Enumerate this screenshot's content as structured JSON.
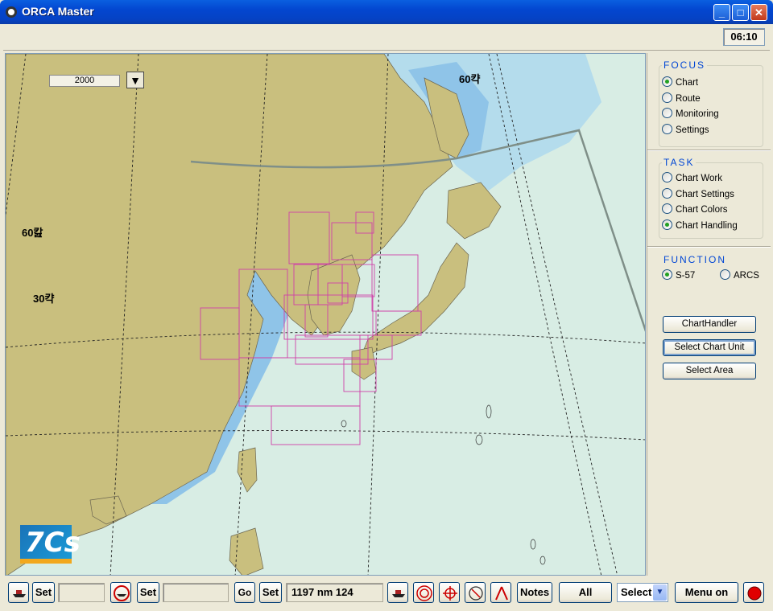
{
  "window": {
    "title": "ORCA Master",
    "minimize": "_",
    "maximize": "□",
    "close": "✕"
  },
  "header": {
    "time": "06:10"
  },
  "map": {
    "scale": "2000",
    "scale_button": "▼",
    "labels": {
      "lat_top": "60캭",
      "left_a": "60캂",
      "left_b": "30캭"
    },
    "colors": {
      "land": "#c9bf7e",
      "sea": "#d8ede4",
      "shallow": "#8fc4e8",
      "mid": "#b4dcec",
      "cells": "#d040a8"
    }
  },
  "panel": {
    "focus": {
      "title": "FOCUS",
      "items": [
        "Chart",
        "Route",
        "Monitoring",
        "Settings"
      ],
      "selected": "Chart"
    },
    "task": {
      "title": "TASK",
      "items": [
        "Chart Work",
        "Chart Settings",
        "Chart Colors",
        "Chart Handling"
      ],
      "selected": "Chart Handling"
    },
    "function": {
      "title": "FUNCTION",
      "items": [
        "S-57",
        "ARCS"
      ],
      "selected": "S-57"
    },
    "buttons": [
      "ChartHandler",
      "Select Chart Unit",
      "Select Area"
    ]
  },
  "bottom": {
    "set1": "Set",
    "field1": "",
    "set2": "Set",
    "field2": "",
    "go": "Go",
    "set3": "Set",
    "readout": "1197 nm  124",
    "notes": "Notes",
    "all": "All",
    "select": "Select",
    "menu": "Menu on"
  },
  "icons": [
    "app-icon",
    "ship-icon",
    "ship-circle-icon",
    "target-icon",
    "crosshair-icon",
    "compass-icon",
    "divider-icon",
    "record-icon",
    "chevron-down-icon"
  ]
}
